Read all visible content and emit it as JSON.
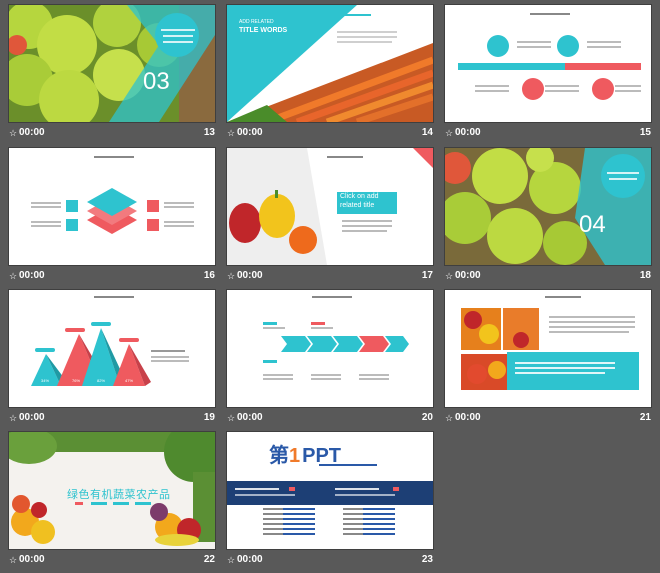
{
  "theme": {
    "teal": "#2ec3cf",
    "red": "#ef5a5f",
    "background": "#595959"
  },
  "common": {
    "duration": "00:00",
    "transition_icon": "star-transition-icon"
  },
  "slides": {
    "s13": {
      "number": "13",
      "section_number": "03"
    },
    "s14": {
      "number": "14",
      "eyebrow": "ADD RELATED",
      "title": "TITLE WORDS"
    },
    "s15": {
      "number": "15"
    },
    "s16": {
      "number": "16"
    },
    "s17": {
      "number": "17",
      "callout_line1": "Click on add",
      "callout_line2": "related title"
    },
    "s18": {
      "number": "18",
      "section_number": "04"
    },
    "s19": {
      "number": "19",
      "percents": [
        "34%",
        "76%",
        "82%",
        "47%"
      ]
    },
    "s20": {
      "number": "20"
    },
    "s21": {
      "number": "21"
    },
    "s22": {
      "number": "22",
      "headline": "绿色有机蔬菜农产品"
    },
    "s23": {
      "number": "23",
      "logo_char": "第",
      "logo_digit": "1",
      "logo_text": "PPT"
    }
  }
}
